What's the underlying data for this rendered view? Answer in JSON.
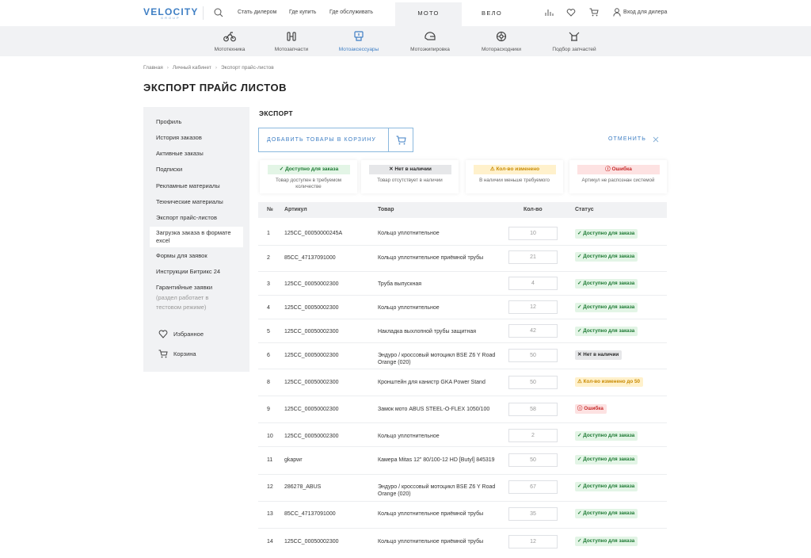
{
  "header": {
    "logo": "VELOCITY",
    "logo_sub": "GROUP",
    "links": [
      "Стать дилером",
      "Где купить",
      "Где обслуживать"
    ],
    "tabs": [
      {
        "label": "МОТО",
        "active": true
      },
      {
        "label": "ВЕЛО",
        "active": false
      }
    ],
    "dealer_login": "Вход для дилера",
    "icons": [
      "search-icon",
      "compare-icon",
      "heart-icon",
      "cart-icon",
      "user-icon"
    ]
  },
  "categories": [
    {
      "label": "Мототехника",
      "icon": "motorcycle-icon",
      "active": false
    },
    {
      "label": "Мотозапчасти",
      "icon": "parts-icon",
      "active": false
    },
    {
      "label": "Мотоаксессуары",
      "icon": "accessories-icon",
      "active": true
    },
    {
      "label": "Мотоэкипировка",
      "icon": "helmet-icon",
      "active": false
    },
    {
      "label": "Моторасходники",
      "icon": "consumables-icon",
      "active": false
    },
    {
      "label": "Подбор запчастей",
      "icon": "parts-selection-icon",
      "active": false
    }
  ],
  "breadcrumbs": [
    "Главная",
    "Личный кабинет",
    "Экспорт прайс-листов"
  ],
  "page_title": "ЭКСПОРТ ПРАЙС ЛИСТОВ",
  "sidebar": {
    "items": [
      {
        "label": "Профиль"
      },
      {
        "label": "История заказов"
      },
      {
        "label": "Активные заказы"
      },
      {
        "label": "Подписки"
      },
      {
        "label": "Рекламные материалы"
      },
      {
        "label": "Технические материалы"
      },
      {
        "label": "Экспорт прайс-листов"
      },
      {
        "label": "Загрузка заказа в формате excel",
        "selected": true
      },
      {
        "label": "Формы для заявок"
      },
      {
        "label": "Инструкции Битрикс 24"
      },
      {
        "label": "Гарантийные заявки"
      }
    ],
    "warranty_note": "(раздел работает в тестовом режиме)",
    "favorites": "Избранное",
    "cart": "Корзина"
  },
  "section_title": "ЭКСПОРТ",
  "actions": {
    "add_to_cart": "ДОБАВИТЬ ТОВАРЫ В КОРЗИНУ",
    "cancel": "ОТМЕНИТЬ"
  },
  "legend": [
    {
      "badge": "Доступно для заказа",
      "desc": "Товар доступен в требуемом количестве",
      "kind": "green",
      "icon": "check-icon"
    },
    {
      "badge": "Нет в наличии",
      "desc": "Товар отсутствует в наличии",
      "kind": "gray",
      "icon": "x-icon"
    },
    {
      "badge": "Кол-во изменено",
      "desc": "В наличии меньше требуемого",
      "kind": "yellow",
      "icon": "warning-icon"
    },
    {
      "badge": "Ошибка",
      "desc": "Артикул не распознан системой",
      "kind": "red",
      "icon": "error-icon"
    }
  ],
  "table": {
    "columns": [
      "№",
      "Артикул",
      "Товар",
      "Кол-во",
      "Статус"
    ],
    "rows": [
      {
        "num": "1",
        "sku": "125CC_00050000245A",
        "product": "Кольцо уплотнительное",
        "qty": "10",
        "status": "Доступно для заказа",
        "kind": "green"
      },
      {
        "num": "2",
        "sku": "85CC_47137091000",
        "product": "Кольцо уплотнительное приёмной трубы",
        "qty": "21",
        "status": "Доступно для заказа",
        "kind": "green"
      },
      {
        "num": "3",
        "sku": "125CC_00050002300",
        "product": "Труба выпускная",
        "qty": "4",
        "status": "Доступно для заказа",
        "kind": "green"
      },
      {
        "num": "4",
        "sku": "125CC_00050002300",
        "product": "Кольцо уплотнительное",
        "qty": "12",
        "status": "Доступно для заказа",
        "kind": "green"
      },
      {
        "num": "5",
        "sku": "125CC_00050002300",
        "product": "Накладка выхлопной трубы защитная",
        "qty": "42",
        "status": "Доступно для заказа",
        "kind": "green"
      },
      {
        "num": "6",
        "sku": "125CC_00050002300",
        "product": "Эндуро / кроссовый мотоцикл BSE Z6 Y Road Orange (020)",
        "qty": "50",
        "status": "Нет в наличии",
        "kind": "gray"
      },
      {
        "num": "8",
        "sku": "125CC_00050002300",
        "product": "Кронштейн для канистр GKA Power Stand",
        "qty": "50",
        "status": "Кол-во изменено до 50",
        "kind": "yellow"
      },
      {
        "num": "9",
        "sku": "125CC_00050002300",
        "product": "Замок мото ABUS STEEL-O-FLEX 1050/100",
        "qty": "58",
        "status": "Ошибка",
        "kind": "red"
      },
      {
        "num": "10",
        "sku": "125CC_00050002300",
        "product": "Кольцо уплотнительное",
        "qty": "2",
        "status": "Доступно для заказа",
        "kind": "green"
      },
      {
        "num": "11",
        "sku": "gkapwr",
        "product": "Камера Mitas 12\" 80/100-12 HD [Butyl] 845319",
        "qty": "50",
        "status": "Доступно для заказа",
        "kind": "green"
      },
      {
        "num": "12",
        "sku": "286278_ABUS",
        "product": "Эндуро / кроссовый мотоцикл BSE Z6 Y Road Orange (020)",
        "qty": "67",
        "status": "Доступно для заказа",
        "kind": "green"
      },
      {
        "num": "13",
        "sku": "85CC_47137091000",
        "product": "Кольцо уплотнительное приёмной трубы",
        "qty": "35",
        "status": "Доступно для заказа",
        "kind": "green"
      },
      {
        "num": "14",
        "sku": "125CC_00050002300",
        "product": "Кольцо уплотнительное приёмной трубы",
        "qty": "12",
        "status": "Доступно для заказа",
        "kind": "green"
      }
    ]
  }
}
